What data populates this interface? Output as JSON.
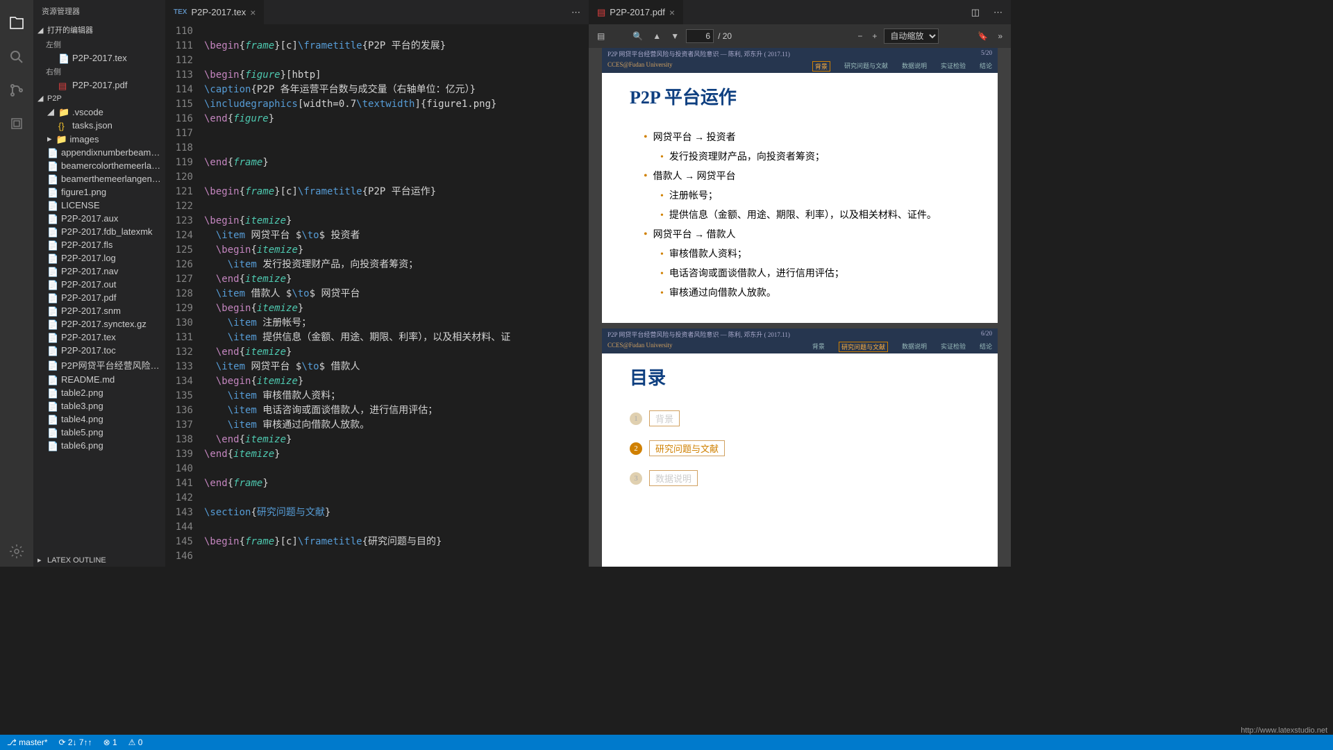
{
  "sidebar": {
    "title": "资源管理器",
    "openEditors": "打开的编辑器",
    "leftGroup": "左侧",
    "rightGroup": "右侧",
    "texFile": "P2P-2017.tex",
    "pdfFile": "P2P-2017.pdf",
    "project": "P2P",
    "vscode": ".vscode",
    "tasks": "tasks.json",
    "images": "images",
    "files": [
      "appendixnumberbeam…",
      "beamercolorthemeerla…",
      "beamerthemeerlangen…",
      "figure1.png",
      "LICENSE",
      "P2P-2017.aux",
      "P2P-2017.fdb_latexmk",
      "P2P-2017.fls",
      "P2P-2017.log",
      "P2P-2017.nav",
      "P2P-2017.out",
      "P2P-2017.pdf",
      "P2P-2017.snm",
      "P2P-2017.synctex.gz",
      "P2P-2017.tex",
      "P2P-2017.toc",
      "P2P网贷平台经营风险…",
      "README.md",
      "table2.png",
      "table3.png",
      "table4.png",
      "table5.png",
      "table6.png"
    ],
    "outline": "LATEX OUTLINE"
  },
  "editor": {
    "tabName": "P2P-2017.tex",
    "startLine": 110,
    "lines": [
      {
        "n": 110,
        "seg": []
      },
      {
        "n": 111,
        "seg": [
          [
            "\\begin",
            "kw"
          ],
          [
            "{",
            "txt"
          ],
          [
            "frame",
            "env"
          ],
          [
            "}[c]",
            "txt"
          ],
          [
            "\\frametitle",
            "cmd"
          ],
          [
            "{P2P 平台的发展}",
            "txt"
          ]
        ]
      },
      {
        "n": 112,
        "seg": []
      },
      {
        "n": 113,
        "seg": [
          [
            "\\begin",
            "kw"
          ],
          [
            "{",
            "txt"
          ],
          [
            "figure",
            "env"
          ],
          [
            "}[hbtp]",
            "txt"
          ]
        ]
      },
      {
        "n": 114,
        "seg": [
          [
            "\\caption",
            "cmd"
          ],
          [
            "{P2P 各年运营平台数与成交量（右轴单位：亿元）}",
            "txt"
          ]
        ]
      },
      {
        "n": 115,
        "seg": [
          [
            "\\includegraphics",
            "cmd"
          ],
          [
            "[width=0.7",
            "txt"
          ],
          [
            "\\textwidth",
            "cmd"
          ],
          [
            "]{figure1.png}",
            "txt"
          ]
        ]
      },
      {
        "n": 116,
        "seg": [
          [
            "\\end",
            "kw"
          ],
          [
            "{",
            "txt"
          ],
          [
            "figure",
            "env"
          ],
          [
            "}",
            "txt"
          ]
        ]
      },
      {
        "n": 117,
        "seg": []
      },
      {
        "n": 118,
        "seg": []
      },
      {
        "n": 119,
        "seg": [
          [
            "\\end",
            "kw"
          ],
          [
            "{",
            "txt"
          ],
          [
            "frame",
            "env"
          ],
          [
            "}",
            "txt"
          ]
        ]
      },
      {
        "n": 120,
        "seg": []
      },
      {
        "n": 121,
        "seg": [
          [
            "\\begin",
            "kw"
          ],
          [
            "{",
            "txt"
          ],
          [
            "frame",
            "env"
          ],
          [
            "}[c]",
            "txt"
          ],
          [
            "\\frametitle",
            "cmd"
          ],
          [
            "{P2P 平台运作}",
            "txt"
          ]
        ]
      },
      {
        "n": 122,
        "seg": []
      },
      {
        "n": 123,
        "seg": [
          [
            "\\begin",
            "kw"
          ],
          [
            "{",
            "txt"
          ],
          [
            "itemize",
            "env"
          ],
          [
            "}",
            "txt"
          ]
        ]
      },
      {
        "n": 124,
        "seg": [
          [
            "  ",
            "txt"
          ],
          [
            "\\item",
            "cmd"
          ],
          [
            " 网贷平台 $",
            "txt"
          ],
          [
            "\\to",
            "cmd"
          ],
          [
            "$ 投资者",
            "txt"
          ]
        ]
      },
      {
        "n": 125,
        "seg": [
          [
            "  ",
            "txt"
          ],
          [
            "\\begin",
            "kw"
          ],
          [
            "{",
            "txt"
          ],
          [
            "itemize",
            "env"
          ],
          [
            "}",
            "txt"
          ]
        ]
      },
      {
        "n": 126,
        "seg": [
          [
            "    ",
            "txt"
          ],
          [
            "\\item",
            "cmd"
          ],
          [
            " 发行投资理财产品，向投资者筹资；",
            "txt"
          ]
        ]
      },
      {
        "n": 127,
        "seg": [
          [
            "  ",
            "txt"
          ],
          [
            "\\end",
            "kw"
          ],
          [
            "{",
            "txt"
          ],
          [
            "itemize",
            "env"
          ],
          [
            "}",
            "txt"
          ]
        ]
      },
      {
        "n": 128,
        "seg": [
          [
            "  ",
            "txt"
          ],
          [
            "\\item",
            "cmd"
          ],
          [
            " 借款人 $",
            "txt"
          ],
          [
            "\\to",
            "cmd"
          ],
          [
            "$ 网贷平台",
            "txt"
          ]
        ]
      },
      {
        "n": 129,
        "seg": [
          [
            "  ",
            "txt"
          ],
          [
            "\\begin",
            "kw"
          ],
          [
            "{",
            "txt"
          ],
          [
            "itemize",
            "env"
          ],
          [
            "}",
            "txt"
          ]
        ]
      },
      {
        "n": 130,
        "seg": [
          [
            "    ",
            "txt"
          ],
          [
            "\\item",
            "cmd"
          ],
          [
            " 注册帐号；",
            "txt"
          ]
        ]
      },
      {
        "n": 131,
        "seg": [
          [
            "    ",
            "txt"
          ],
          [
            "\\item",
            "cmd"
          ],
          [
            " 提供信息（金额、用途、期限、利率），以及相关材料、证",
            "txt"
          ]
        ]
      },
      {
        "n": 132,
        "seg": [
          [
            "  ",
            "txt"
          ],
          [
            "\\end",
            "kw"
          ],
          [
            "{",
            "txt"
          ],
          [
            "itemize",
            "env"
          ],
          [
            "}",
            "txt"
          ]
        ]
      },
      {
        "n": 133,
        "seg": [
          [
            "  ",
            "txt"
          ],
          [
            "\\item",
            "cmd"
          ],
          [
            " 网贷平台 $",
            "txt"
          ],
          [
            "\\to",
            "cmd"
          ],
          [
            "$ 借款人",
            "txt"
          ]
        ]
      },
      {
        "n": 134,
        "seg": [
          [
            "  ",
            "txt"
          ],
          [
            "\\begin",
            "kw"
          ],
          [
            "{",
            "txt"
          ],
          [
            "itemize",
            "env"
          ],
          [
            "}",
            "txt"
          ]
        ]
      },
      {
        "n": 135,
        "seg": [
          [
            "    ",
            "txt"
          ],
          [
            "\\item",
            "cmd"
          ],
          [
            " 审核借款人资料；",
            "txt"
          ]
        ]
      },
      {
        "n": 136,
        "seg": [
          [
            "    ",
            "txt"
          ],
          [
            "\\item",
            "cmd"
          ],
          [
            " 电话咨询或面谈借款人，进行信用评估；",
            "txt"
          ]
        ]
      },
      {
        "n": 137,
        "seg": [
          [
            "    ",
            "txt"
          ],
          [
            "\\item",
            "cmd"
          ],
          [
            " 审核通过向借款人放款。",
            "txt"
          ]
        ]
      },
      {
        "n": 138,
        "seg": [
          [
            "  ",
            "txt"
          ],
          [
            "\\end",
            "kw"
          ],
          [
            "{",
            "txt"
          ],
          [
            "itemize",
            "env"
          ],
          [
            "}",
            "txt"
          ]
        ]
      },
      {
        "n": 139,
        "seg": [
          [
            "\\end",
            "kw"
          ],
          [
            "{",
            "txt"
          ],
          [
            "itemize",
            "env"
          ],
          [
            "}",
            "txt"
          ]
        ]
      },
      {
        "n": 140,
        "seg": []
      },
      {
        "n": 141,
        "seg": [
          [
            "\\end",
            "kw"
          ],
          [
            "{",
            "txt"
          ],
          [
            "frame",
            "env"
          ],
          [
            "}",
            "txt"
          ]
        ]
      },
      {
        "n": 142,
        "seg": []
      },
      {
        "n": 143,
        "seg": [
          [
            "\\section",
            "cmd"
          ],
          [
            "{",
            "txt"
          ],
          [
            "研究问题与文献",
            "cmd"
          ],
          [
            "}",
            "txt"
          ]
        ]
      },
      {
        "n": 144,
        "seg": []
      },
      {
        "n": 145,
        "seg": [
          [
            "\\begin",
            "kw"
          ],
          [
            "{",
            "txt"
          ],
          [
            "frame",
            "env"
          ],
          [
            "}[c]",
            "txt"
          ],
          [
            "\\frametitle",
            "cmd"
          ],
          [
            "{研究问题与目的}",
            "txt"
          ]
        ]
      },
      {
        "n": 146,
        "seg": []
      }
    ]
  },
  "pdf": {
    "tabName": "P2P-2017.pdf",
    "pageInput": "6",
    "pageTotal": "/ 20",
    "zoom": "自动缩放",
    "headerLeft": "P2P 网贷平台经营风险与投资者风险意识 — 陈利, 邓东升 ( 2017.11)",
    "headerRight5": "5/20",
    "headerRight6": "6/20",
    "univ": "CCES@Fudan University",
    "nav": [
      "背景",
      "研究问题与文献",
      "数据说明",
      "实证检验",
      "结论"
    ],
    "slide1": {
      "title": "P2P 平台运作",
      "items": [
        {
          "t": "网贷平台 → 投资者",
          "sub": [
            "发行投资理财产品，向投资者筹资；"
          ]
        },
        {
          "t": "借款人 → 网贷平台",
          "sub": [
            "注册帐号；",
            "提供信息（金额、用途、期限、利率），以及相关材料、证件。"
          ]
        },
        {
          "t": "网贷平台 → 借款人",
          "sub": [
            "审核借款人资料；",
            "电话咨询或面谈借款人，进行信用评估；",
            "审核通过向借款人放款。"
          ]
        }
      ]
    },
    "slide2": {
      "title": "目录",
      "toc": [
        {
          "n": "1",
          "label": "背景",
          "state": "faded"
        },
        {
          "n": "2",
          "label": "研究问题与文献",
          "state": "active"
        },
        {
          "n": "3",
          "label": "数据说明",
          "state": "faded"
        }
      ]
    }
  },
  "status": {
    "branch": "master*",
    "sync": "⟳ 2↓ 7↑↑",
    "errors": "⊗ 1",
    "warnings": "⚠ 0"
  },
  "watermark": "http://www.latexstudio.net"
}
